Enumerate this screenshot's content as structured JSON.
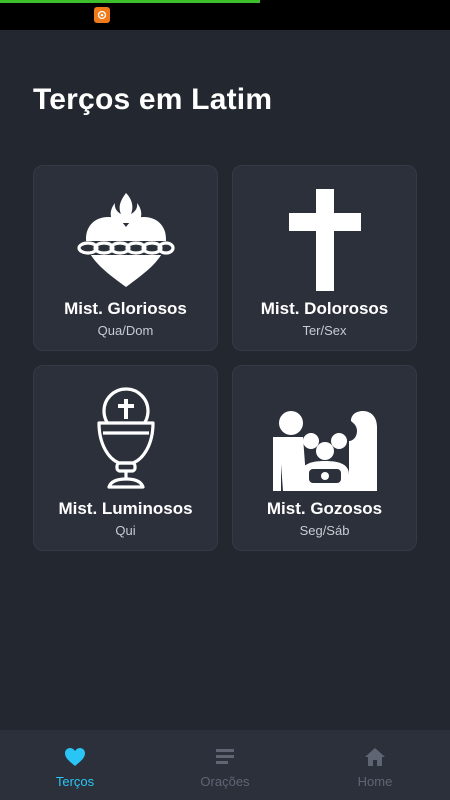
{
  "app": {
    "title": "Terços em Latim"
  },
  "cards": [
    {
      "id": "gloriosos",
      "name": "Mist. Gloriosos",
      "days": "Qua/Dom",
      "icon": "sacred-heart-icon"
    },
    {
      "id": "dolorosos",
      "name": "Mist. Dolorosos",
      "days": "Ter/Sex",
      "icon": "cross-icon"
    },
    {
      "id": "luminosos",
      "name": "Mist. Luminosos",
      "days": "Qui",
      "icon": "chalice-icon"
    },
    {
      "id": "gozosos",
      "name": "Mist. Gozosos",
      "days": "Seg/Sáb",
      "icon": "nativity-icon"
    }
  ],
  "bottom_nav": {
    "items": [
      {
        "label": "Terços",
        "icon": "heart-icon",
        "active": true
      },
      {
        "label": "Orações",
        "icon": "list-icon",
        "active": false
      },
      {
        "label": "Home",
        "icon": "home-icon",
        "active": false
      }
    ]
  },
  "colors": {
    "background": "#232730",
    "card": "#2b303b",
    "accent": "#29c6f5",
    "inactive_nav": "#5f6573",
    "notification": "#f07a1a"
  }
}
